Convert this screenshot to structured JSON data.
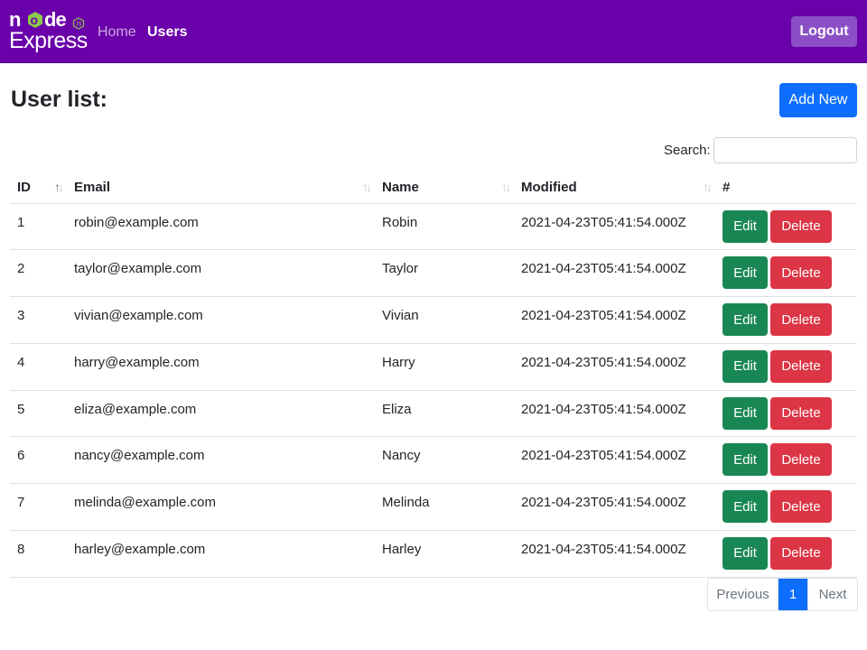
{
  "navbar": {
    "logo_top": "node",
    "logo_badge": "JS",
    "logo_bottom": "Express",
    "links": [
      {
        "label": "Home"
      },
      {
        "label": "Users"
      }
    ],
    "logout_label": "Logout",
    "brand_color": "#6a00aa"
  },
  "header": {
    "title": "User list:",
    "add_label": "Add New"
  },
  "search": {
    "label": "Search:",
    "value": ""
  },
  "table": {
    "columns": [
      "ID",
      "Email",
      "Name",
      "Modified",
      "#"
    ],
    "rows": [
      {
        "id": "1",
        "email": "robin@example.com",
        "name": "Robin",
        "modified": "2021-04-23T05:41:54.000Z"
      },
      {
        "id": "2",
        "email": "taylor@example.com",
        "name": "Taylor",
        "modified": "2021-04-23T05:41:54.000Z"
      },
      {
        "id": "3",
        "email": "vivian@example.com",
        "name": "Vivian",
        "modified": "2021-04-23T05:41:54.000Z"
      },
      {
        "id": "4",
        "email": "harry@example.com",
        "name": "Harry",
        "modified": "2021-04-23T05:41:54.000Z"
      },
      {
        "id": "5",
        "email": "eliza@example.com",
        "name": "Eliza",
        "modified": "2021-04-23T05:41:54.000Z"
      },
      {
        "id": "6",
        "email": "nancy@example.com",
        "name": "Nancy",
        "modified": "2021-04-23T05:41:54.000Z"
      },
      {
        "id": "7",
        "email": "melinda@example.com",
        "name": "Melinda",
        "modified": "2021-04-23T05:41:54.000Z"
      },
      {
        "id": "8",
        "email": "harley@example.com",
        "name": "Harley",
        "modified": "2021-04-23T05:41:54.000Z"
      }
    ],
    "edit_label": "Edit",
    "delete_label": "Delete"
  },
  "pagination": {
    "previous_label": "Previous",
    "current_page": "1",
    "next_label": "Next"
  }
}
